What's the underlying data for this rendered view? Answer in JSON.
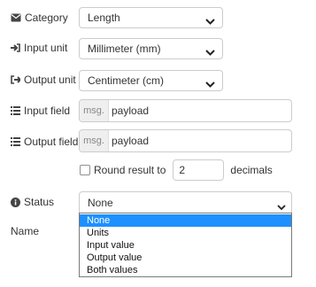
{
  "fields": {
    "category": {
      "label": "Category",
      "value": "Length",
      "icon": "envelope-icon"
    },
    "input_unit": {
      "label": "Input unit",
      "value": "Millimeter (mm)",
      "icon": "sign-in-icon"
    },
    "output_unit": {
      "label": "Output unit",
      "value": "Centimeter (cm)",
      "icon": "sign-out-icon"
    },
    "input_field": {
      "label": "Input field",
      "type": "msg.",
      "value": "payload",
      "icon": "list-icon"
    },
    "output_field": {
      "label": "Output field",
      "type": "msg.",
      "value": "payload",
      "icon": "list-icon"
    }
  },
  "round": {
    "label": "Round result to",
    "checked": false,
    "value": "2",
    "suffix": "decimals"
  },
  "status": {
    "label": "Status",
    "icon": "info-circle-icon",
    "value": "None",
    "options": [
      "None",
      "Units",
      "Input value",
      "Output value",
      "Both values"
    ],
    "selected_index": 0
  },
  "name": {
    "label": "Name"
  },
  "colors": {
    "highlight": "#1e90ff",
    "border": "#cccccc",
    "text": "#333333"
  }
}
